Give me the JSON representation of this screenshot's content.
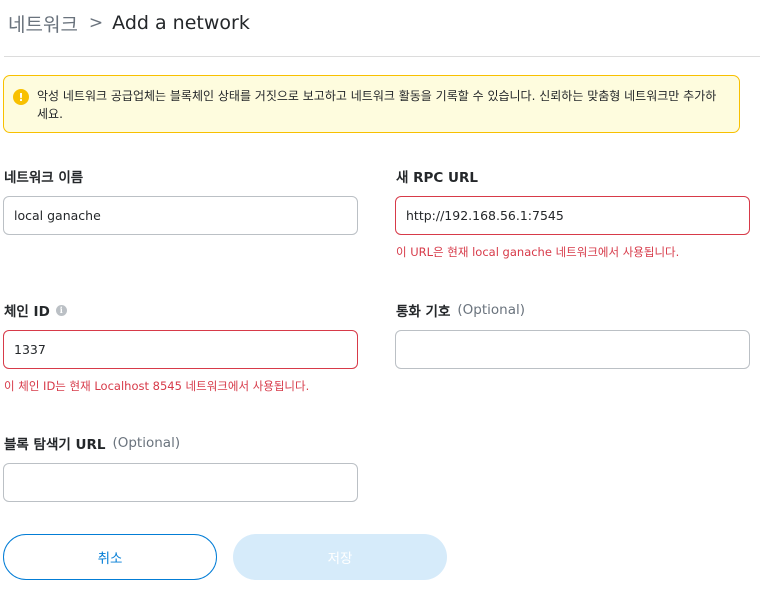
{
  "breadcrumb": {
    "parent": "네트워크",
    "separator": ">",
    "title": "Add a network"
  },
  "warning": {
    "text": "악성 네트워크 공급업체는 블록체인 상태를 거짓으로 보고하고 네트워크 활동을 기록할 수 있습니다. 신뢰하는 맞춤형 네트워크만 추가하세요."
  },
  "form": {
    "network_name": {
      "label": "네트워크 이름",
      "value": "local ganache"
    },
    "rpc_url": {
      "label": "새 RPC URL",
      "value": "http://192.168.56.1:7545",
      "error": "이 URL은 현재 local ganache 네트워크에서 사용됩니다."
    },
    "chain_id": {
      "label": "체인 ID",
      "value": "1337",
      "error": "이 체인 ID는 현재 Localhost 8545 네트워크에서 사용됩니다."
    },
    "currency_symbol": {
      "label": "통화 기호",
      "optional": "(Optional)",
      "value": ""
    },
    "block_explorer": {
      "label": "블록 탐색기 URL",
      "optional": "(Optional)",
      "value": ""
    }
  },
  "buttons": {
    "cancel": "취소",
    "save": "저장"
  },
  "colors": {
    "primary": "#037dd6",
    "error": "#d73a49",
    "warning_border": "#f8c000",
    "warning_bg": "#fefcde"
  }
}
